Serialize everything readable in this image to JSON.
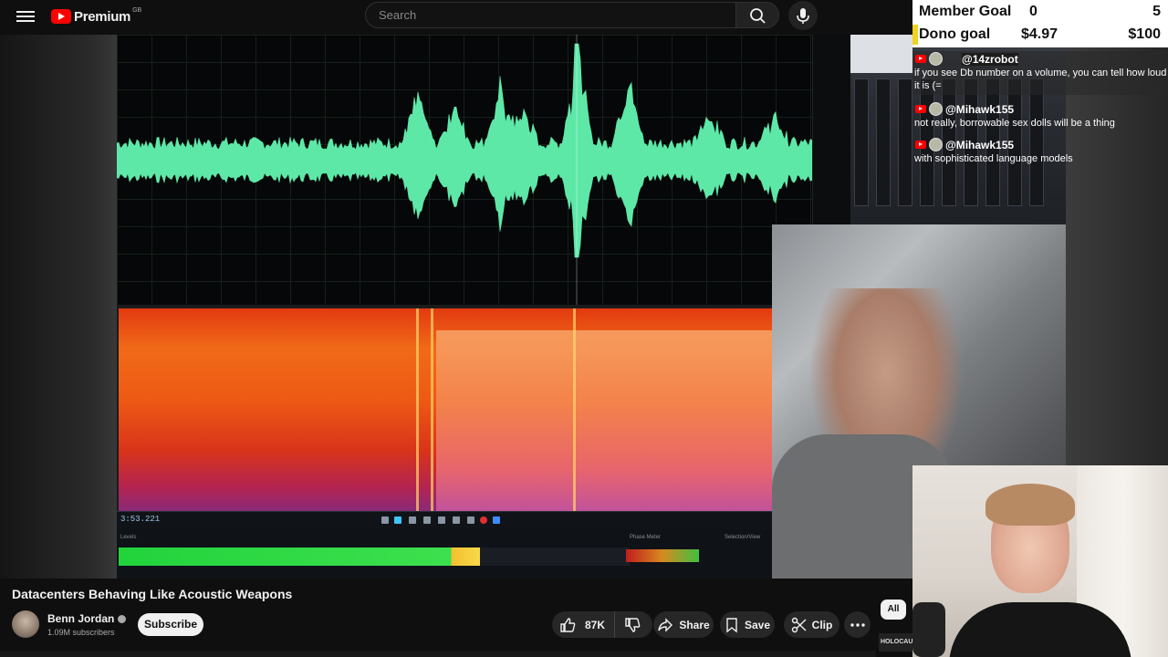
{
  "header": {
    "logo_text": "Premium",
    "logo_region": "GB",
    "search_placeholder": "Search"
  },
  "video_frame": {
    "timecode": "3:53.221",
    "levels_label": "Levels",
    "phase_label": "Phase Meter",
    "selection_label": "Selection/View"
  },
  "overlay": {
    "goals": [
      {
        "name": "Member Goal",
        "current": "0",
        "target": "5"
      },
      {
        "name": "Dono goal",
        "current": "$4.97",
        "target": "$100"
      }
    ],
    "chat": [
      {
        "author": "@14zrobot",
        "message": "if you see Db number on a volume, you can tell how loud it is (="
      },
      {
        "author": "@Mihawk155",
        "message": "not really, borrowable sex dolls will be a thing"
      },
      {
        "author": "@Mihawk155",
        "message": "with sophisticated language models"
      }
    ]
  },
  "video": {
    "title": "Datacenters Behaving Like Acoustic Weapons",
    "channel": "Benn Jordan",
    "subscribers": "1.09M subscribers",
    "subscribe_label": "Subscribe",
    "likes": "87K",
    "share_label": "Share",
    "save_label": "Save",
    "clip_label": "Clip"
  },
  "sidebar": {
    "chip_all": "All",
    "thumb_text": "HOLOCAUS"
  },
  "colors": {
    "waveform": "#5ee8a8",
    "youtube_red": "#ff0000",
    "dono_marker": "#f1d321"
  }
}
